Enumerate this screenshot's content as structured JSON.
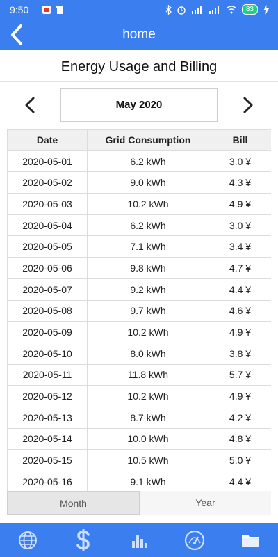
{
  "status": {
    "time": "9:50",
    "battery": "83"
  },
  "appbar": {
    "title": "home"
  },
  "page": {
    "title": "Energy Usage and Billing"
  },
  "month_nav": {
    "current_month": "May 2020"
  },
  "table": {
    "headers": [
      "Date",
      "Grid Consumption",
      "Bill"
    ],
    "rows": [
      [
        "2020-05-01",
        "6.2 kWh",
        "3.0 ¥"
      ],
      [
        "2020-05-02",
        "9.0 kWh",
        "4.3 ¥"
      ],
      [
        "2020-05-03",
        "10.2 kWh",
        "4.9 ¥"
      ],
      [
        "2020-05-04",
        "6.2 kWh",
        "3.0 ¥"
      ],
      [
        "2020-05-05",
        "7.1 kWh",
        "3.4 ¥"
      ],
      [
        "2020-05-06",
        "9.8 kWh",
        "4.7 ¥"
      ],
      [
        "2020-05-07",
        "9.2 kWh",
        "4.4 ¥"
      ],
      [
        "2020-05-08",
        "9.7 kWh",
        "4.6 ¥"
      ],
      [
        "2020-05-09",
        "10.2 kWh",
        "4.9 ¥"
      ],
      [
        "2020-05-10",
        "8.0 kWh",
        "3.8 ¥"
      ],
      [
        "2020-05-11",
        "11.8 kWh",
        "5.7 ¥"
      ],
      [
        "2020-05-12",
        "10.2 kWh",
        "4.9 ¥"
      ],
      [
        "2020-05-13",
        "8.7 kWh",
        "4.2 ¥"
      ],
      [
        "2020-05-14",
        "10.0 kWh",
        "4.8 ¥"
      ],
      [
        "2020-05-15",
        "10.5 kWh",
        "5.0 ¥"
      ],
      [
        "2020-05-16",
        "9.1 kWh",
        "4.4 ¥"
      ]
    ]
  },
  "tabs": [
    {
      "label": "Month",
      "active": true
    },
    {
      "label": "Year",
      "active": false
    }
  ],
  "bottom_nav": [
    {
      "icon": "globe-icon"
    },
    {
      "icon": "dollar-icon"
    },
    {
      "icon": "bar-chart-icon"
    },
    {
      "icon": "gauge-icon"
    },
    {
      "icon": "folder-icon"
    }
  ],
  "colors": {
    "primary": "#3b7ef0"
  }
}
